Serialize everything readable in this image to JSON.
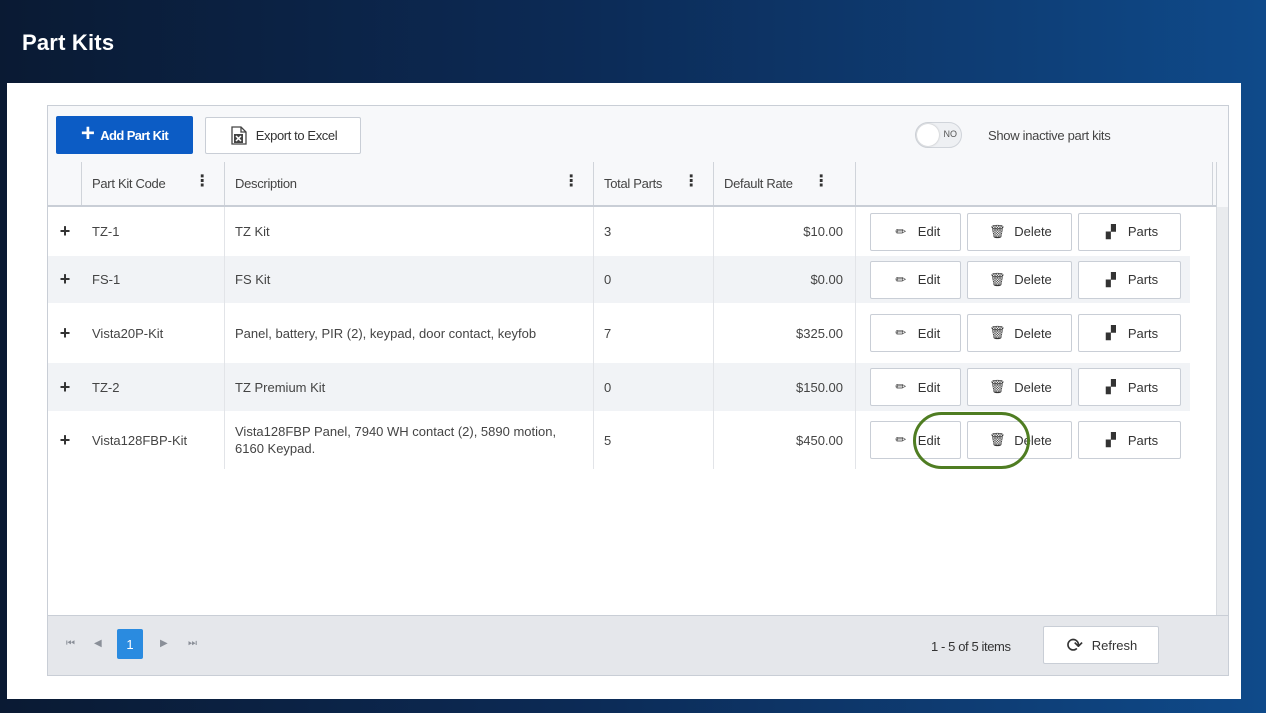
{
  "page": {
    "title": "Part Kits"
  },
  "toolbar": {
    "add_label": "Add Part Kit",
    "export_label": "Export to Excel",
    "toggle_state": "NO",
    "toggle_label": "Show inactive part kits"
  },
  "columns": {
    "code": "Part Kit Code",
    "description": "Description",
    "total": "Total Parts",
    "rate": "Default Rate"
  },
  "actions": {
    "edit": "Edit",
    "delete": "Delete",
    "parts": "Parts"
  },
  "rows": [
    {
      "code": "TZ-1",
      "description": "TZ Kit",
      "total": "3",
      "rate": "$10.00"
    },
    {
      "code": "FS-1",
      "description": "FS Kit",
      "total": "0",
      "rate": "$0.00"
    },
    {
      "code": "Vista20P-Kit",
      "description": "Panel, battery, PIR (2), keypad, door contact, keyfob",
      "total": "7",
      "rate": "$325.00"
    },
    {
      "code": "TZ-2",
      "description": "TZ Premium Kit",
      "total": "0",
      "rate": "$150.00"
    },
    {
      "code": "Vista128FBP-Kit",
      "description": "Vista128FBP Panel, 7940 WH contact (2), 5890 motion, 6160 Keypad.",
      "total": "5",
      "rate": "$450.00"
    }
  ],
  "pager": {
    "current_page": "1",
    "info": "1 - 5 of 5 items",
    "refresh_label": "Refresh"
  },
  "colors": {
    "primary": "#0c5cc5",
    "page_active": "#2a8be0",
    "highlight": "#4f7d22"
  }
}
